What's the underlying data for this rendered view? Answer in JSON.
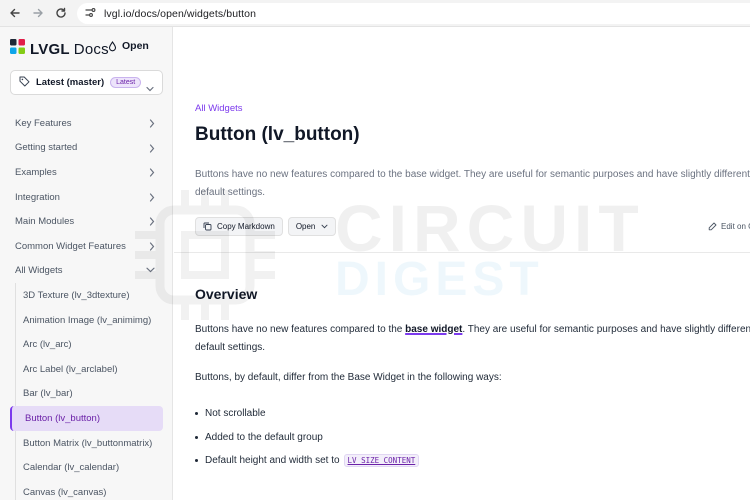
{
  "browser": {
    "url": "lvgl.io/docs/open/widgets/button"
  },
  "sidebar": {
    "brand": "LVGL",
    "brand_suffix": "Docs",
    "theme_label": "Open",
    "version_label": "Latest (master)",
    "version_badge": "Latest",
    "nav": [
      {
        "label": "Key Features"
      },
      {
        "label": "Getting started"
      },
      {
        "label": "Examples"
      },
      {
        "label": "Integration"
      },
      {
        "label": "Main Modules"
      },
      {
        "label": "Common Widget Features"
      },
      {
        "label": "All Widgets"
      }
    ],
    "widgets": [
      {
        "label": "3D Texture (lv_3dtexture)"
      },
      {
        "label": "Animation Image (lv_animimg)"
      },
      {
        "label": "Arc (lv_arc)"
      },
      {
        "label": "Arc Label (lv_arclabel)"
      },
      {
        "label": "Bar (lv_bar)"
      },
      {
        "label": "Button (lv_button)"
      },
      {
        "label": "Button Matrix (lv_buttonmatrix)"
      },
      {
        "label": "Calendar (lv_calendar)"
      },
      {
        "label": "Canvas (lv_canvas)"
      }
    ]
  },
  "main": {
    "breadcrumb": "All Widgets",
    "title": "Button (lv_button)",
    "description": "Buttons have no new features compared to the base widget. They are useful for semantic purposes and have slightly different default settings.",
    "copy_markdown": "Copy Markdown",
    "open_label": "Open",
    "edit_label": "Edit on GitHub",
    "overview_heading": "Overview",
    "overview_p1_before": "Buttons have no new features compared to the",
    "overview_p1_link": "base widget",
    "overview_p1_after": ". They are useful for semantic purposes and have slightly different default settings.",
    "overview_p2": "Buttons, by default, differ from the Base Widget in the following ways:",
    "bullet1": "Not scrollable",
    "bullet2": "Added to the default group",
    "bullet3": "Default height and width set to",
    "bullet3_code": "LV_SIZE_CONTENT"
  },
  "watermark": {
    "line1": "CIRCUIT",
    "line2": "DIGEST"
  },
  "colors": {
    "accent": "#7c3aed",
    "active_bg": "#e6dcf7"
  }
}
